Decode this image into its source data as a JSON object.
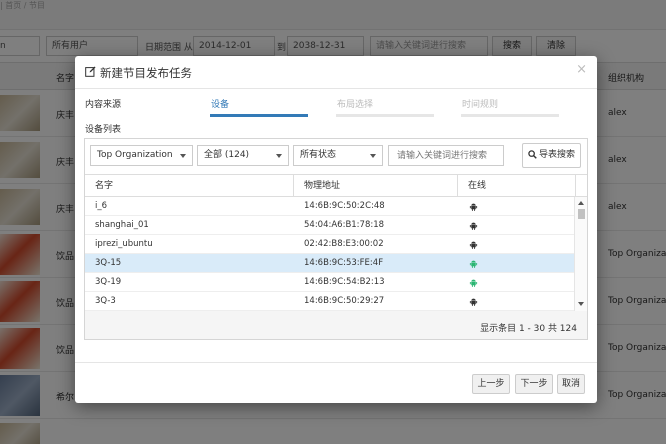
{
  "background": {
    "breadcrumb": "| 首页 / 节目",
    "user_filter": "所有用户",
    "date_label": "日期范围 从",
    "date_from": "2014-12-01",
    "date_to_label": "到",
    "date_to": "2038-12-31",
    "keyword_placeholder": "请输入关键词进行搜索",
    "search_label": "搜索",
    "clear_label": "清除",
    "col_name": "名字",
    "col_org": "组织机构",
    "rows": [
      {
        "name": "庆丰",
        "org": "alex"
      },
      {
        "name": "庆丰",
        "org": "alex"
      },
      {
        "name": "庆丰",
        "org": "alex"
      },
      {
        "name": "饮品",
        "org": "Top Organization"
      },
      {
        "name": "饮品",
        "org": "Top Organization"
      },
      {
        "name": "饮品",
        "org": "Top Organization"
      },
      {
        "name": "希尔",
        "org": "Top Organization"
      }
    ]
  },
  "modal": {
    "title": "新建节目发布任务",
    "close": "×",
    "steps": {
      "source": "内容来源",
      "device": "设备",
      "layout": "布局选择",
      "time": "时间规则"
    },
    "list_title": "设备列表",
    "filters": {
      "org": "Top Organization",
      "group": "全部 (124)",
      "status": "所有状态",
      "keyword_placeholder": "请输入关键词进行搜索",
      "search_button": "导表搜索"
    },
    "columns": {
      "name": "名字",
      "mac": "物理地址",
      "online": "在线"
    },
    "devices": [
      {
        "name": "i_6",
        "mac": "14:6B:9C:50:2C:48",
        "online": false
      },
      {
        "name": "shanghai_01",
        "mac": "54:04:A6:B1:78:18",
        "online": false
      },
      {
        "name": "iprezi_ubuntu",
        "mac": "02:42:B8:E3:00:02",
        "online": false
      },
      {
        "name": "3Q-15",
        "mac": "14:6B:9C:53:FE:4F",
        "online": true,
        "selected": true
      },
      {
        "name": "3Q-19",
        "mac": "14:6B:9C:54:B2:13",
        "online": true
      },
      {
        "name": "3Q-3",
        "mac": "14:6B:9C:50:29:27",
        "online": false
      }
    ],
    "pager": "显示条目 1 - 30 共 124",
    "buttons": {
      "prev": "上一步",
      "next": "下一步",
      "cancel": "取消"
    }
  },
  "colors": {
    "accent": "#337ab7",
    "online": "#2bb673",
    "offline": "#333333",
    "selected_row": "#d9ebf9"
  }
}
